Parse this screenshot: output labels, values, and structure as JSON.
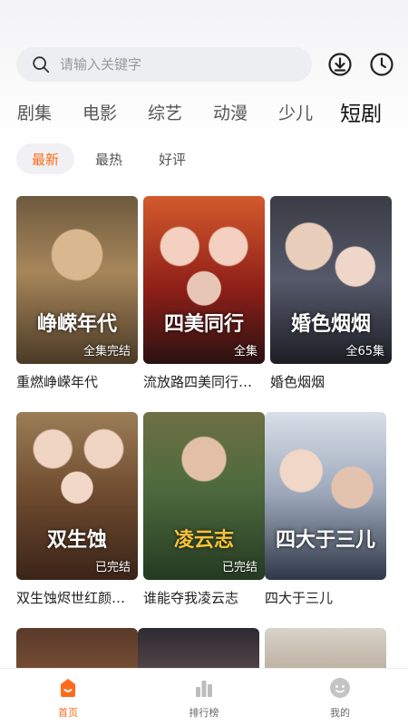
{
  "search": {
    "placeholder": "请输入关键字"
  },
  "categories": [
    {
      "label": "剧集"
    },
    {
      "label": "电影"
    },
    {
      "label": "综艺"
    },
    {
      "label": "动漫"
    },
    {
      "label": "少儿"
    },
    {
      "label": "短剧",
      "active": true
    }
  ],
  "sort_tabs": [
    {
      "label": "最新",
      "active": true
    },
    {
      "label": "最热"
    },
    {
      "label": "好评"
    }
  ],
  "dramas": [
    {
      "title": "重燃峥嵘年代",
      "poster_text": "峥嵘年代",
      "badge": "全集完结"
    },
    {
      "title": "流放路四美同行…",
      "poster_text": "四美同行",
      "badge": "全集"
    },
    {
      "title": "婚色烟烟",
      "poster_text": "婚色烟烟",
      "badge": "全65集"
    },
    {
      "title": "双生蚀烬世红颜…",
      "poster_text": "双生蚀",
      "badge": "已完结"
    },
    {
      "title": "谁能夺我凌云志",
      "poster_text": "凌云志",
      "badge": "已完结"
    },
    {
      "title": "四大于三儿",
      "poster_text": "四大于三儿",
      "badge": ""
    }
  ],
  "bottom_nav": [
    {
      "label": "首页",
      "icon": "home-icon",
      "active": true
    },
    {
      "label": "排行榜",
      "icon": "ranking-icon"
    },
    {
      "label": "我的",
      "icon": "profile-icon"
    }
  ],
  "colors": {
    "accent": "#ff6a1a",
    "search_bg": "#eceef1"
  }
}
